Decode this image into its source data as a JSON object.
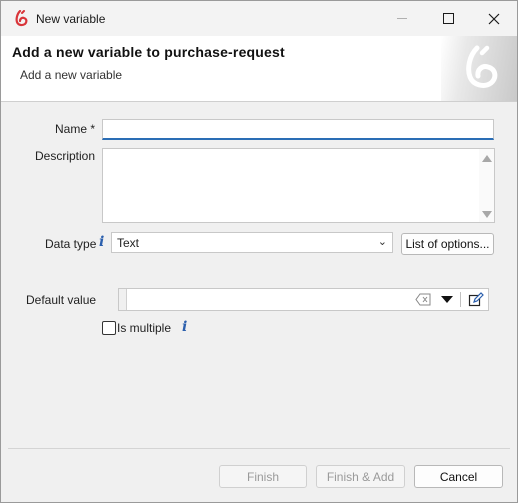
{
  "window": {
    "title": "New variable",
    "controls": {
      "minimize": "minimize",
      "maximize": "maximize",
      "close": "close"
    }
  },
  "header": {
    "title": "Add a new variable to purchase-request",
    "subtitle": "Add a new variable"
  },
  "form": {
    "name": {
      "label": "Name",
      "required_marker": "*",
      "value": ""
    },
    "description": {
      "label": "Description",
      "value": ""
    },
    "data_type": {
      "label": "Data type",
      "info_glyph": "i",
      "selected": "Text"
    },
    "list_options_button": "List of options...",
    "default_value": {
      "label": "Default value",
      "value": ""
    },
    "is_multiple": {
      "label": "Is multiple",
      "checked": false,
      "info_glyph": "i"
    }
  },
  "footer": {
    "finish": "Finish",
    "finish_add": "Finish & Add",
    "cancel": "Cancel"
  },
  "colors": {
    "accent": "#2a6db5",
    "logo_red": "#d9353a",
    "info_blue": "#2b5fad"
  },
  "icons": [
    "bonita-logo-icon",
    "minimize-icon",
    "maximize-icon",
    "close-icon",
    "info-icon",
    "chevron-down-icon",
    "clear-icon",
    "dropdown-arrow-icon",
    "edit-icon"
  ]
}
